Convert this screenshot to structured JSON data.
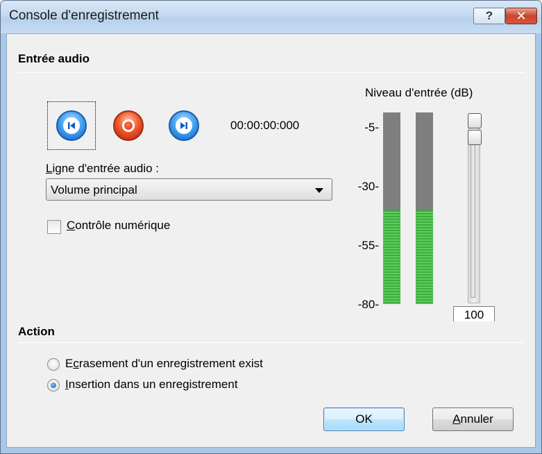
{
  "window": {
    "title": "Console d'enregistrement",
    "help_glyph": "?",
    "close_glyph": "✕"
  },
  "audio_input": {
    "section_title": "Entrée audio",
    "timecode": "00:00:00:000",
    "line_label_underline": "L",
    "line_label_rest": "igne d'entrée audio :",
    "line_value": "Volume principal",
    "digital_control_underline": "C",
    "digital_control_rest": "ontrôle numérique",
    "digital_control_checked": false
  },
  "level": {
    "title": "Niveau d'entrée (dB)",
    "ticks": [
      "-5-",
      "-30-",
      "-55-",
      "-80-"
    ],
    "meter_left_fill": 0.49,
    "meter_right_fill": 0.49,
    "slider_value": "100"
  },
  "action": {
    "section_title": "Action",
    "option1_pre": "E",
    "option1_underline": "c",
    "option1_rest": "rasement d'un enregistrement exist",
    "option1_selected": false,
    "option2_underline": "I",
    "option2_rest": "nsertion dans un enregistrement",
    "option2_selected": true
  },
  "buttons": {
    "ok": "OK",
    "cancel_underline": "A",
    "cancel_rest": "nnuler"
  },
  "colors": {
    "meter_green": "#3fae3f",
    "meter_gray": "#7f7f7f",
    "record_red": "#e02a0c",
    "transport_blue": "#0b5fc6"
  }
}
